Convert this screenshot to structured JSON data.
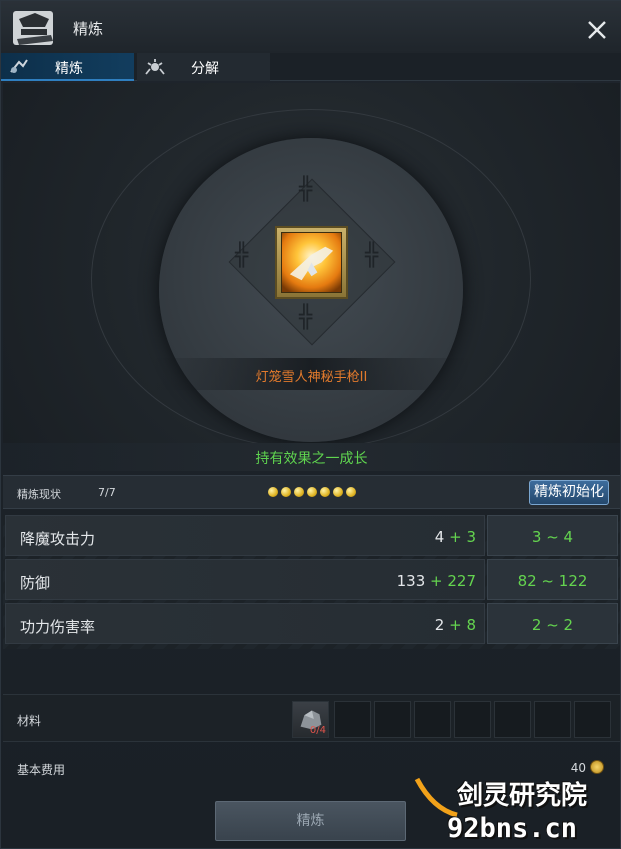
{
  "window": {
    "title": "精炼"
  },
  "tabs": [
    {
      "label": "精炼",
      "active": true,
      "icon": "refine-icon"
    },
    {
      "label": "分解",
      "active": false,
      "icon": "decompose-icon"
    }
  ],
  "item": {
    "name": "灯笼雪人神秘手枪II",
    "name_color": "#e27a2c"
  },
  "effect": {
    "text": "持有效果之一成长"
  },
  "status": {
    "label": "精炼现状",
    "value": "7/7",
    "filled_dots": 7,
    "reset_button": "精炼初始化"
  },
  "stats": [
    {
      "name": "降魔攻击力",
      "base": "4",
      "bonus": "+ 3",
      "range": "3 ~ 4"
    },
    {
      "name": "防御",
      "base": "133",
      "bonus": "+ 227",
      "range": "82 ~ 122"
    },
    {
      "name": "功力伤害率",
      "base": "2",
      "bonus": "+ 8",
      "range": "2 ~ 2"
    }
  ],
  "materials": {
    "label": "材料",
    "count": "0/4",
    "empty_slots": 7
  },
  "cost": {
    "label": "基本费用",
    "value": "40"
  },
  "refine_button": "精炼",
  "watermark": {
    "line1": "剑灵研究院",
    "line2": "92bns.cn"
  },
  "colors": {
    "accent": "#2f7fc0",
    "positive": "#64d44f",
    "gold": "#e0b423"
  }
}
